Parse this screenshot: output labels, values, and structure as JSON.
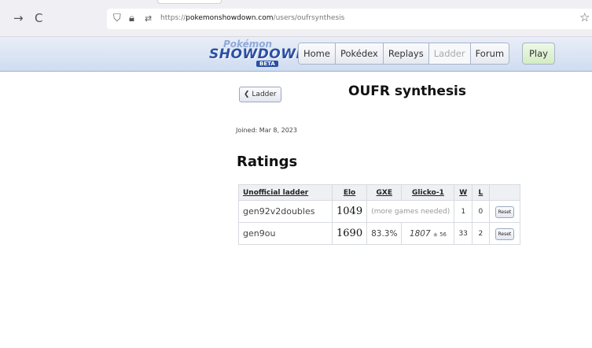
{
  "browser": {
    "url_prefix": "https://",
    "url_domain": "pokemonshowdown.com",
    "url_path": "/users/oufrsynthesis"
  },
  "header": {
    "logo_top": "Pokémon",
    "logo_main": "SHOWDOWN",
    "logo_beta": "BETA",
    "nav": [
      "Home",
      "Pokédex",
      "Replays",
      "Ladder",
      "Forum"
    ],
    "active_nav": "Ladder",
    "play_label": "Play"
  },
  "page": {
    "back_label": "Ladder",
    "title": "OUFR synthesis",
    "joined": "Joined: Mar 8, 2023",
    "ratings_heading": "Ratings"
  },
  "ratings_table": {
    "headers": [
      "Unofficial ladder",
      "Elo",
      "GXE",
      "Glicko-1",
      "W",
      "L"
    ],
    "rows": [
      {
        "format": "gen92v2doubles",
        "elo": "1049",
        "note": "(more games needed)",
        "w": "1",
        "l": "0",
        "reset": "Reset"
      },
      {
        "format": "gen9ou",
        "elo": "1690",
        "gxe": "83.3%",
        "glicko": "1807",
        "glicko_dev": "± 56",
        "w": "33",
        "l": "2",
        "reset": "Reset"
      }
    ]
  }
}
